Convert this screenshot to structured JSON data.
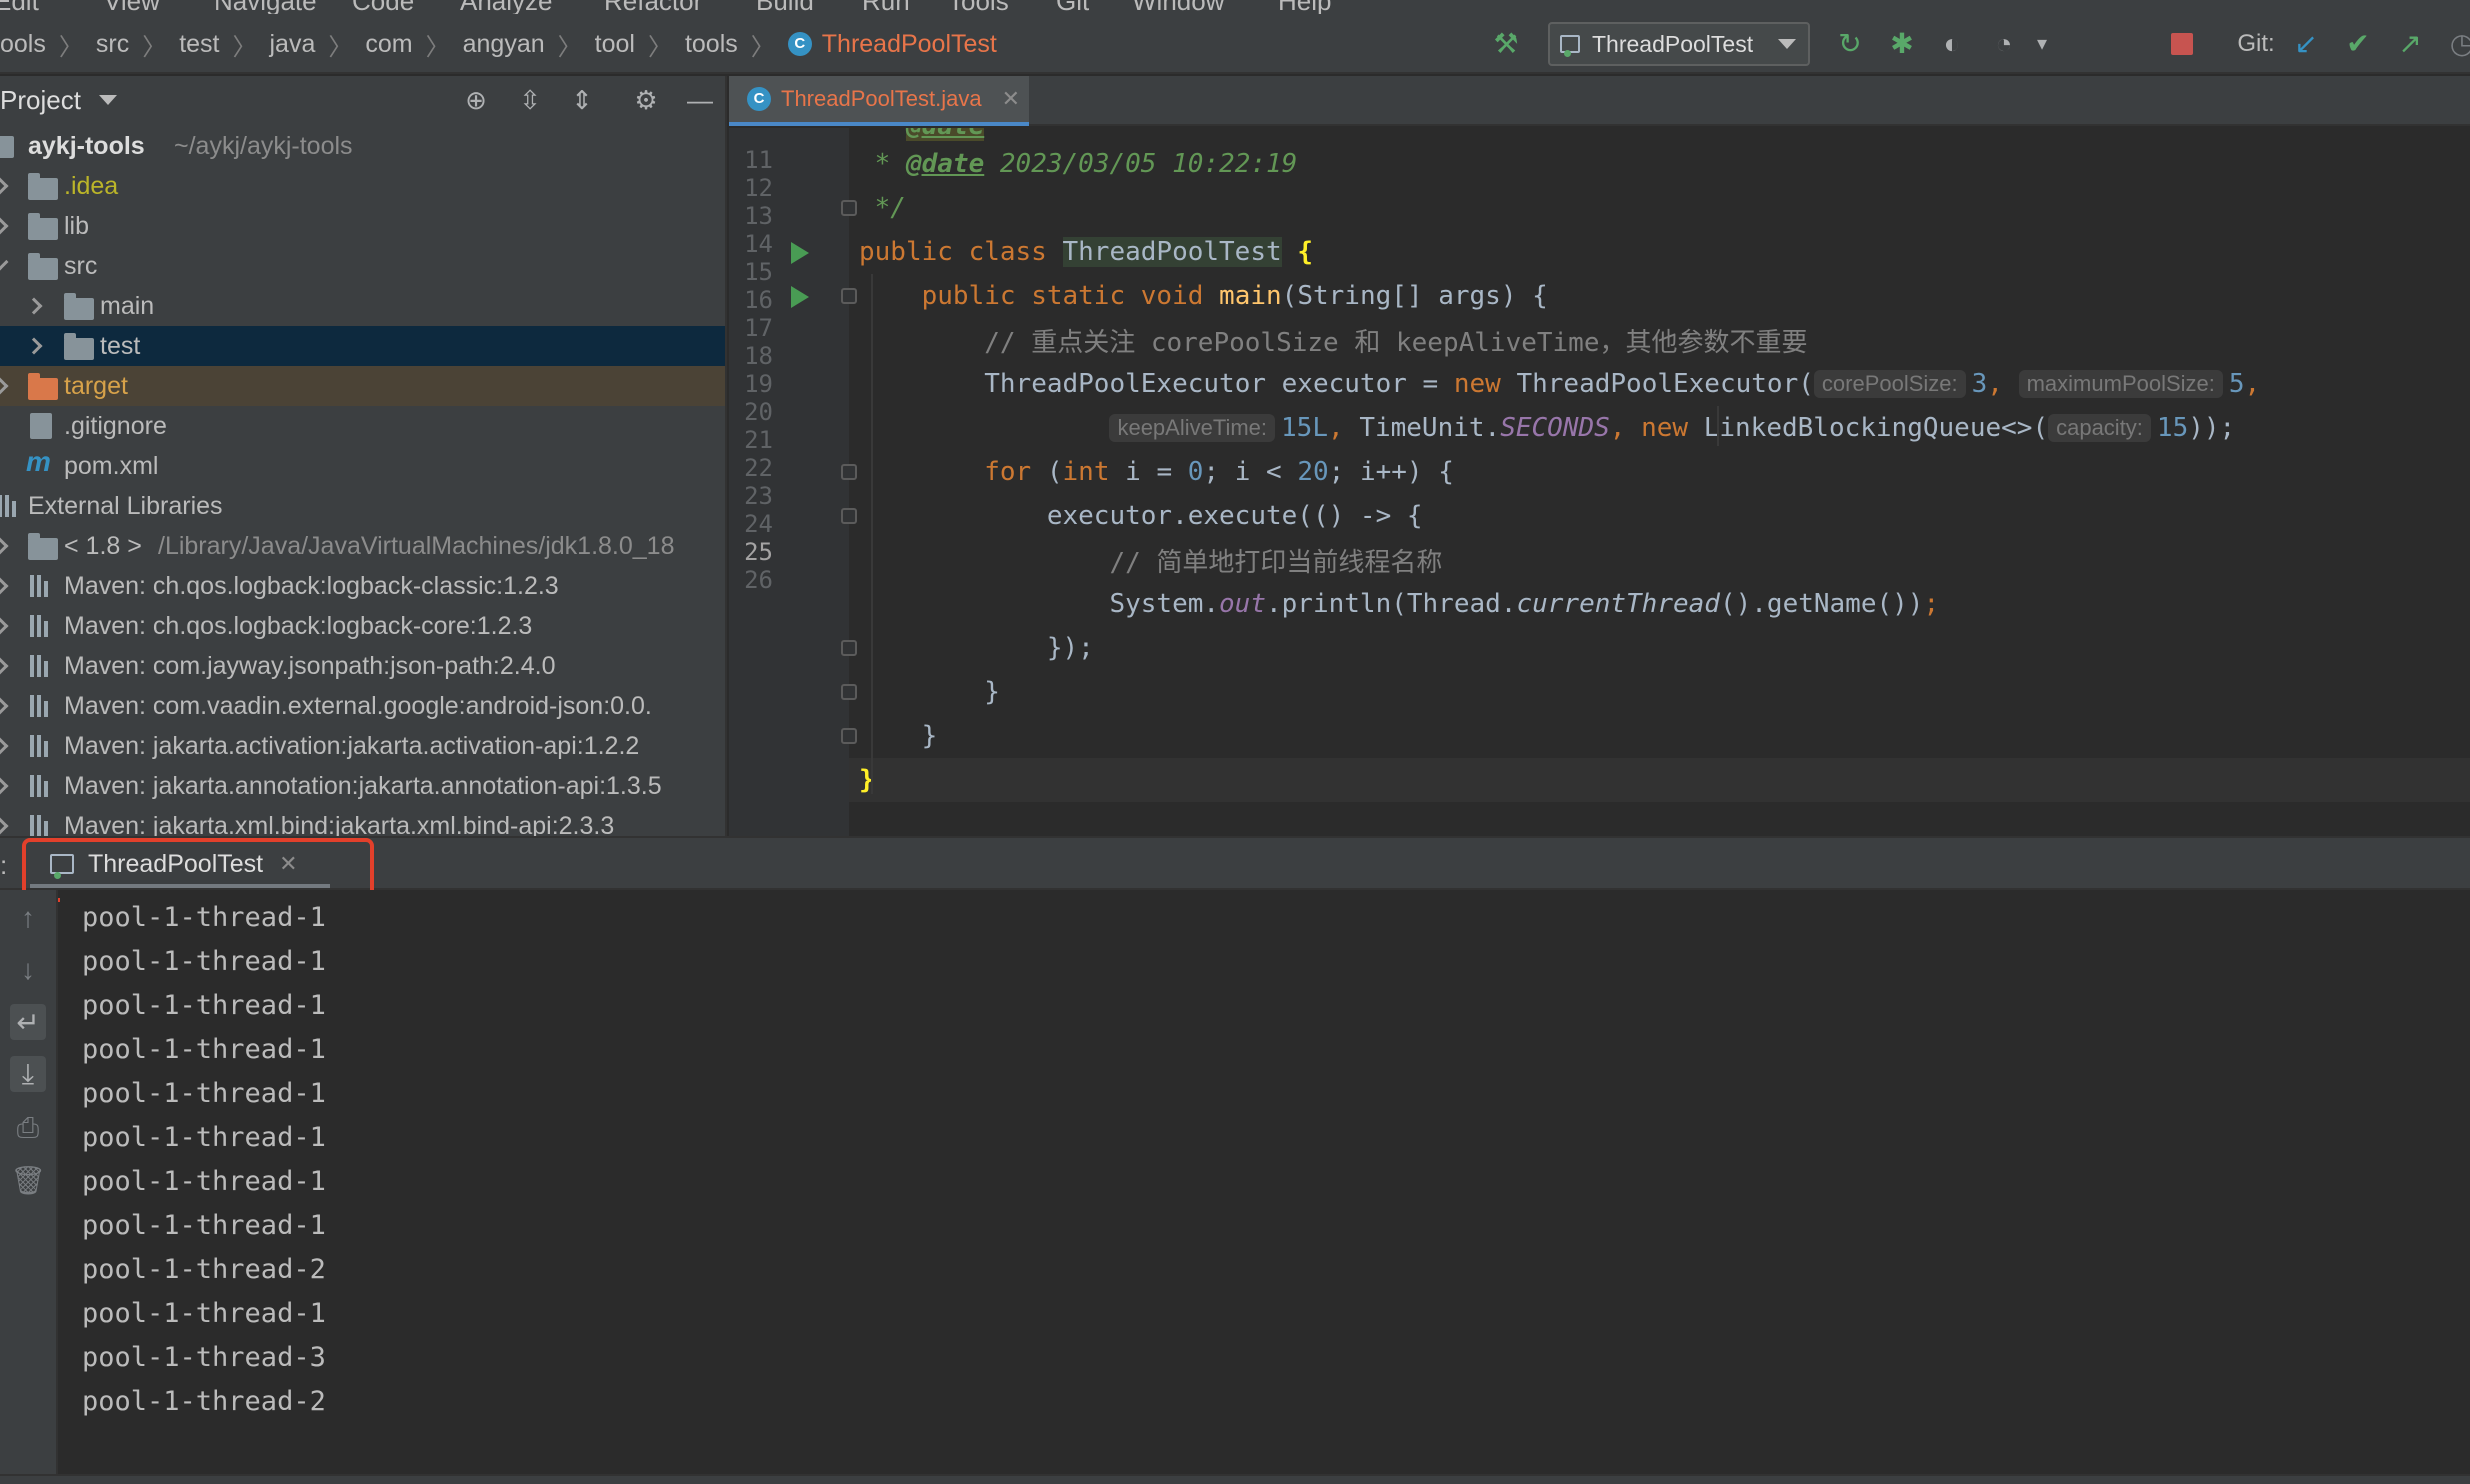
{
  "menu": [
    "Edit",
    "View",
    "Navigate",
    "Code",
    "Analyze",
    "Refactor",
    "Build",
    "Run",
    "Tools",
    "Git",
    "Window",
    "Help"
  ],
  "breadcrumb": [
    "ools",
    "src",
    "test",
    "java",
    "com",
    "angyan",
    "tool",
    "tools",
    "ThreadPoolTest"
  ],
  "run_config": "ThreadPoolTest",
  "git_label": "Git:",
  "project": {
    "title": "Project",
    "root_name": "aykj-tools",
    "root_path": "~/aykj/aykj-tools",
    "items": [
      ".idea",
      "lib",
      "src",
      "main",
      "test",
      "target",
      ".gitignore",
      "pom.xml",
      "External Libraries",
      "< 1.8 >",
      "Maven: ch.qos.logback:logback-classic:1.2.3",
      "Maven: ch.qos.logback:logback-core:1.2.3",
      "Maven: com.jayway.jsonpath:json-path:2.4.0",
      "Maven: com.vaadin.external.google:android-json:0.0.",
      "Maven: jakarta.activation:jakarta.activation-api:1.2.2",
      "Maven: jakarta.annotation:jakarta.annotation-api:1.3.5",
      "Maven: jakarta.xml.bind:jakarta.xml.bind-api:2.3.3"
    ],
    "jdk_path": "/Library/Java/JavaVirtualMachines/jdk1.8.0_18"
  },
  "editor": {
    "tab_label": "ThreadPoolTest.java",
    "line_numbers": [
      "11",
      "12",
      "13",
      "14",
      "15",
      "16",
      "17",
      "18",
      "19",
      "20",
      "21",
      "22",
      "23",
      "24",
      "25",
      "26"
    ],
    "code": {
      "l11_star": " * ",
      "l11_tag": "@date",
      "l11_rest": " 2023/03/05 10:22:19",
      "l12": " */",
      "l13_kw": "public class ",
      "l13_cls": "ThreadPoolTest",
      "l13_brace": "{",
      "l14_kw": "public static void ",
      "l14_fn": "main",
      "l14_rest": "(String[] args) {",
      "l15": "// 重点关注 corePoolSize 和 keepAliveTime，其他参数不重要",
      "l16_a": "ThreadPoolExecutor executor = ",
      "l16_new": "new ",
      "l16_b": "ThreadPoolExecutor(",
      "l16_hint1": "corePoolSize:",
      "l16_v1": "3",
      "l16_comma1": ", ",
      "l16_hint2": "maximumPoolSize:",
      "l16_v2": "5",
      "l16_comma2": ",",
      "l17_hint1": "keepAliveTime:",
      "l17_v1": "15L",
      "l17_c1": ", ",
      "l17_cls": "TimeUnit.",
      "l17_static": "SECONDS",
      "l17_c2": ", ",
      "l17_new": "new ",
      "l17_b": "LinkedBlockingQueue<>(",
      "l17_hint2": "capacity:",
      "l17_v2": "15",
      "l17_end": "));",
      "l18_kw1": "for ",
      "l18_a": "(",
      "l18_kw2": "int ",
      "l18_b": "i = ",
      "l18_v1": "0",
      "l18_c": "; i < ",
      "l18_v2": "20",
      "l18_d": "; i++) {",
      "l19": "executor.execute(() -> {",
      "l20": "// 简单地打印当前线程名称",
      "l21_a": "System.",
      "l21_out": "out",
      "l21_b": ".println(Thread.",
      "l21_call": "currentThread",
      "l21_c": "().getName())",
      "l21_semi": ";",
      "l22": "});",
      "l23": "}",
      "l24": "}",
      "l25": "}"
    }
  },
  "run": {
    "tab_label": "ThreadPoolTest",
    "colon": ":",
    "output": [
      "pool-1-thread-1",
      "pool-1-thread-1",
      "pool-1-thread-1",
      "pool-1-thread-1",
      "pool-1-thread-1",
      "pool-1-thread-1",
      "pool-1-thread-1",
      "pool-1-thread-1",
      "pool-1-thread-2",
      "pool-1-thread-1",
      "pool-1-thread-3",
      "pool-1-thread-2"
    ]
  },
  "colors": {
    "highlight_box": "#e2402b",
    "accent": "#4a88c7",
    "run_green": "#499c54"
  }
}
